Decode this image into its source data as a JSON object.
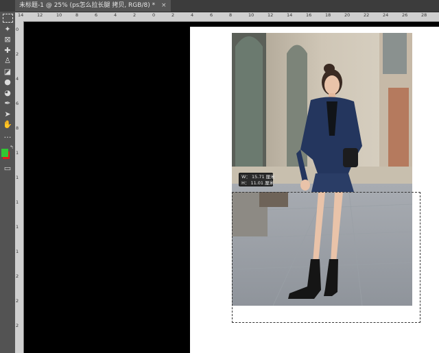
{
  "document_tab": {
    "title": "未标题-1 @ 25% (ps怎么拉长腿 拷贝, RGB/8) *",
    "close": "×"
  },
  "toolbar": {
    "tools": [
      {
        "name": "marquee-tool-icon",
        "glyph": "⬚"
      },
      {
        "name": "magic-wand-icon",
        "glyph": "✦"
      },
      {
        "name": "frame-tool-icon",
        "glyph": "⊠"
      },
      {
        "name": "healing-brush-icon",
        "glyph": "✚"
      },
      {
        "name": "clone-stamp-icon",
        "glyph": "♙"
      },
      {
        "name": "eraser-icon",
        "glyph": "◪"
      },
      {
        "name": "blur-drop-icon",
        "glyph": "●"
      },
      {
        "name": "dodge-icon",
        "glyph": "◕"
      },
      {
        "name": "pen-tool-icon",
        "glyph": "✒"
      },
      {
        "name": "path-select-icon",
        "glyph": "➤"
      },
      {
        "name": "hand-tool-icon",
        "glyph": "✋"
      },
      {
        "name": "more-tools-icon",
        "glyph": "…"
      }
    ],
    "colors": {
      "foreground": "#31c733",
      "background": "#e21b1b"
    },
    "swap_glyph": "↰",
    "screen_mode_glyph": "▭"
  },
  "rulers": {
    "horizontal": [
      "14",
      "12",
      "10",
      "8",
      "6",
      "4",
      "2",
      "0",
      "2",
      "4",
      "6",
      "8",
      "10",
      "12",
      "14",
      "16",
      "18",
      "20",
      "22",
      "24",
      "26",
      "28"
    ],
    "vertical": [
      "0",
      "2",
      "4",
      "6",
      "8",
      "1",
      "1",
      "1",
      "1",
      "1",
      "2",
      "2",
      "2"
    ]
  },
  "transform_hud": {
    "w_line": "W： 15.71 厘米",
    "h_line": "H： 11.01 厘米"
  },
  "colors": {
    "canvas_bg": "#000000",
    "document_bg": "#ffffff"
  }
}
